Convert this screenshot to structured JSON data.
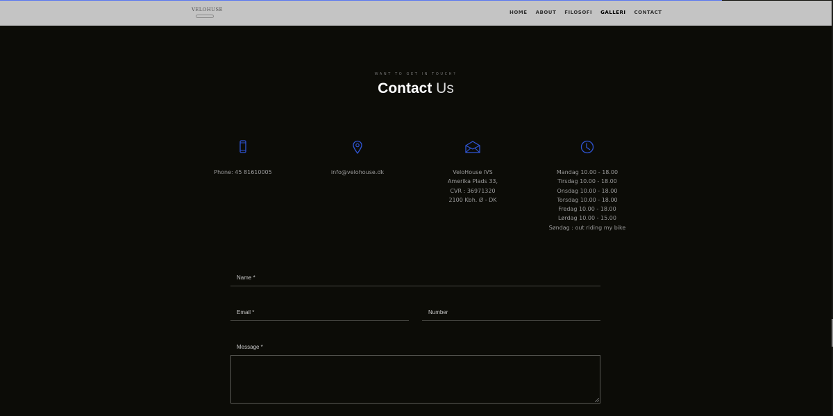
{
  "header": {
    "logo_text": "VELOHUSE",
    "nav": [
      "HOME",
      "ABOUT",
      "FILOSOFI",
      "GALLERI",
      "CONTACT"
    ],
    "active_nav": "GALLERI"
  },
  "section": {
    "eyebrow": "WANT TO GET IN TOUCH?",
    "title_bold": "Contact",
    "title_light": "Us"
  },
  "contact_info": {
    "phone": {
      "icon": "phone-icon",
      "lines": [
        "Phone: 45 81610005"
      ]
    },
    "email": {
      "icon": "location-pin-icon",
      "lines": [
        "info@velohouse.dk"
      ]
    },
    "address": {
      "icon": "envelope-icon",
      "lines": [
        "VeloHouse IVS",
        "Amerika Plads 33,",
        "CVR : 36971320",
        "2100 Kbh. Ø - DK"
      ]
    },
    "hours": {
      "icon": "clock-icon",
      "lines": [
        "Mandag 10.00 - 18.00",
        "Tirsdag 10.00 - 18.00",
        "Onsdag 10.00 - 18.00",
        "Torsdag 10.00 - 18.00",
        "Fredag 10.00 - 18.00",
        "Lørdag 10.00 - 15.00",
        "Søndag : out riding my bike"
      ]
    }
  },
  "form": {
    "name_label": "Name *",
    "email_label": "Email *",
    "number_label": "Number",
    "message_label": "Message *"
  },
  "colors": {
    "accent_icon": "#2f55d4",
    "background": "#0c0c07",
    "header_bg": "#c4c4c4"
  }
}
